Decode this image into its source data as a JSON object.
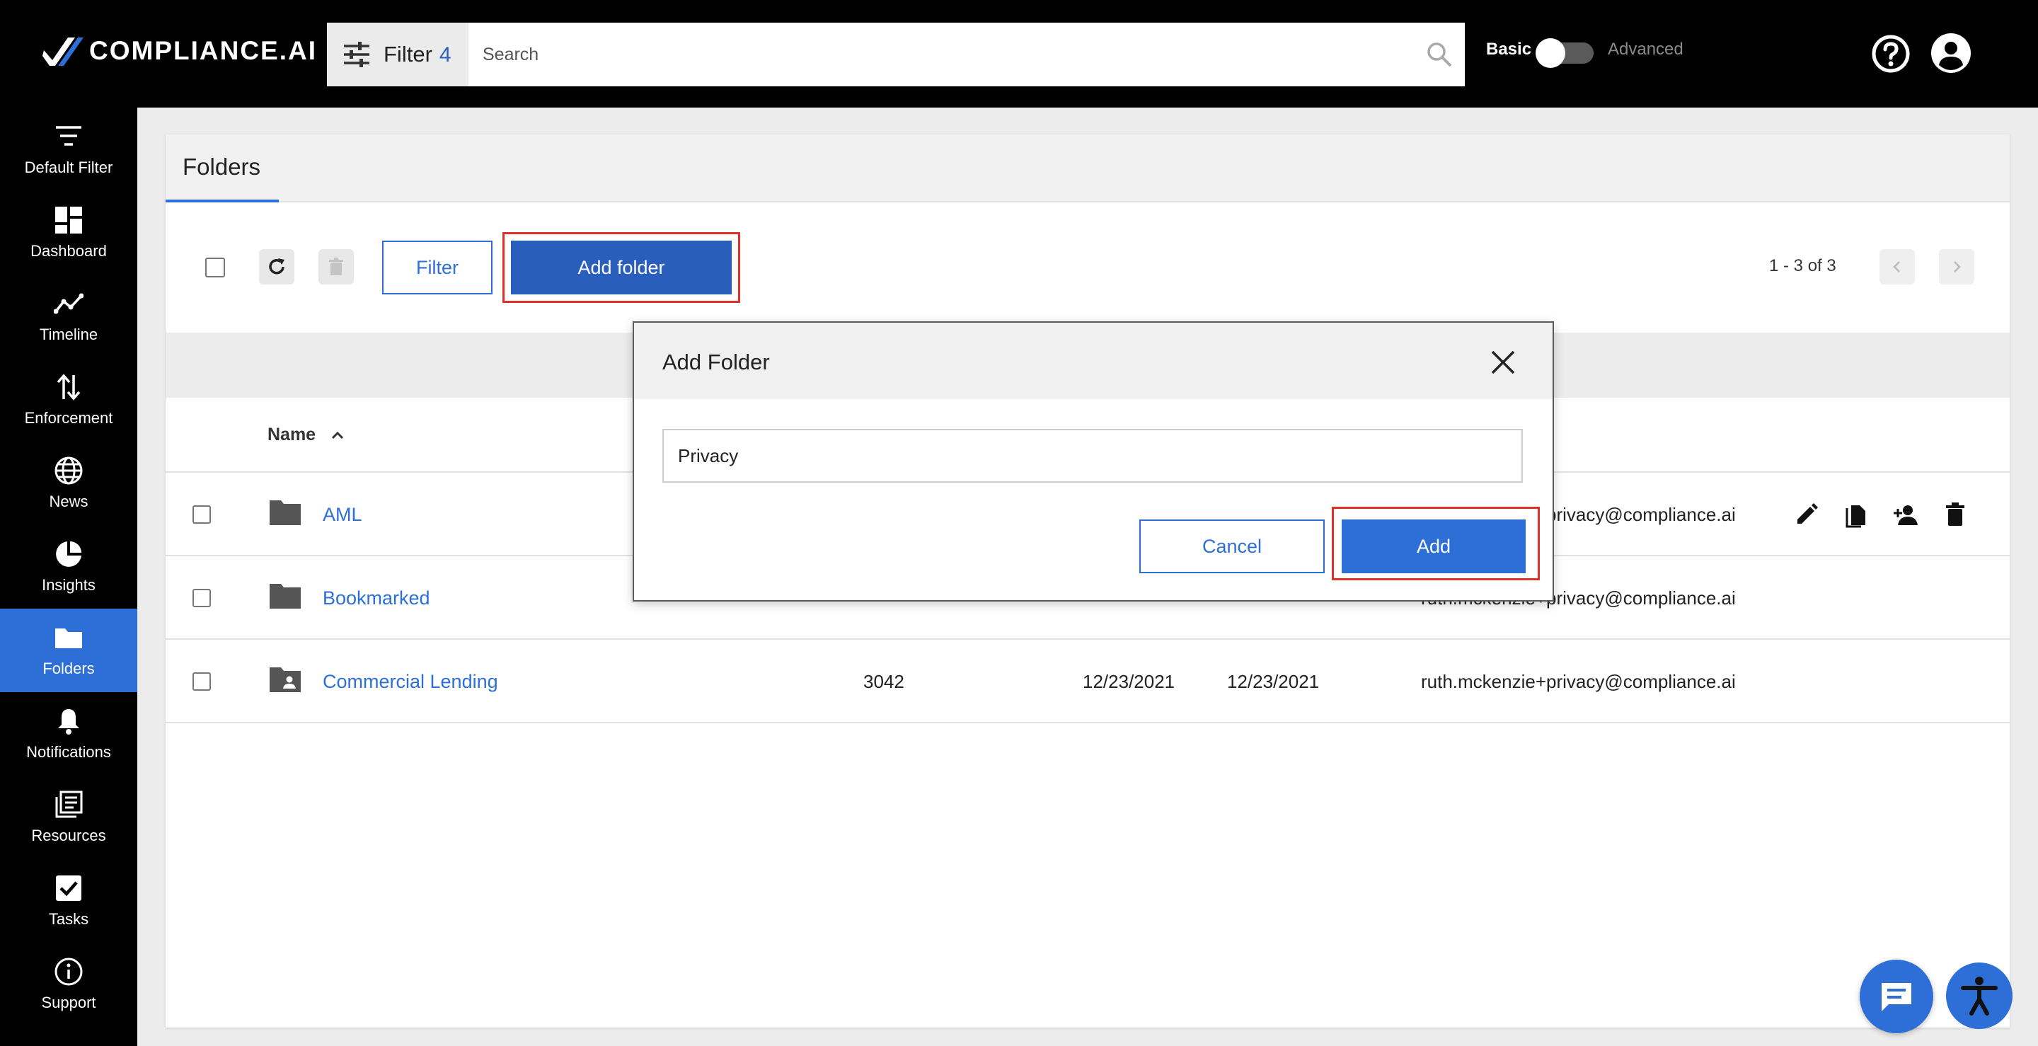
{
  "brand": {
    "name": "COMPLIANCE",
    "suffix": ".AI"
  },
  "search": {
    "filter_label": "Filter",
    "filter_count": "4",
    "placeholder": "Search",
    "value": ""
  },
  "mode": {
    "basic": "Basic",
    "advanced": "Advanced"
  },
  "sidebar": {
    "items": [
      {
        "label": "Default Filter",
        "icon": "filter-lines-icon"
      },
      {
        "label": "Dashboard",
        "icon": "dashboard-icon"
      },
      {
        "label": "Timeline",
        "icon": "timeline-icon"
      },
      {
        "label": "Enforcement",
        "icon": "enforcement-icon"
      },
      {
        "label": "News",
        "icon": "globe-icon"
      },
      {
        "label": "Insights",
        "icon": "pie-chart-icon"
      },
      {
        "label": "Folders",
        "icon": "folder-icon",
        "active": true
      },
      {
        "label": "Notifications",
        "icon": "bell-icon"
      },
      {
        "label": "Resources",
        "icon": "library-icon"
      },
      {
        "label": "Tasks",
        "icon": "checkbox-icon"
      },
      {
        "label": "Support",
        "icon": "info-icon"
      }
    ]
  },
  "page": {
    "tab": "Folders"
  },
  "toolbar": {
    "filter_label": "Filter",
    "add_folder_label": "Add folder",
    "pagination": "1 - 3 of 3"
  },
  "table": {
    "name_header": "Name",
    "rows": [
      {
        "name": "AML",
        "count": "",
        "created": "",
        "updated": "",
        "owner": "ruth.mckenzie+privacy@compliance.ai",
        "owner_visible": "privacy@compliance.ai",
        "shared": false
      },
      {
        "name": "Bookmarked",
        "count": "",
        "created": "",
        "updated": "",
        "owner": "ruth.mckenzie+privacy@compliance.ai",
        "shared": false
      },
      {
        "name": "Commercial Lending",
        "count": "3042",
        "created": "12/23/2021",
        "updated": "12/23/2021",
        "owner": "ruth.mckenzie+privacy@compliance.ai",
        "shared": true
      }
    ]
  },
  "modal": {
    "title": "Add Folder",
    "input_value": "Privacy",
    "cancel_label": "Cancel",
    "add_label": "Add"
  },
  "colors": {
    "accent": "#2d6fd6",
    "highlight": "#e0302a",
    "topbar": "#000000"
  }
}
